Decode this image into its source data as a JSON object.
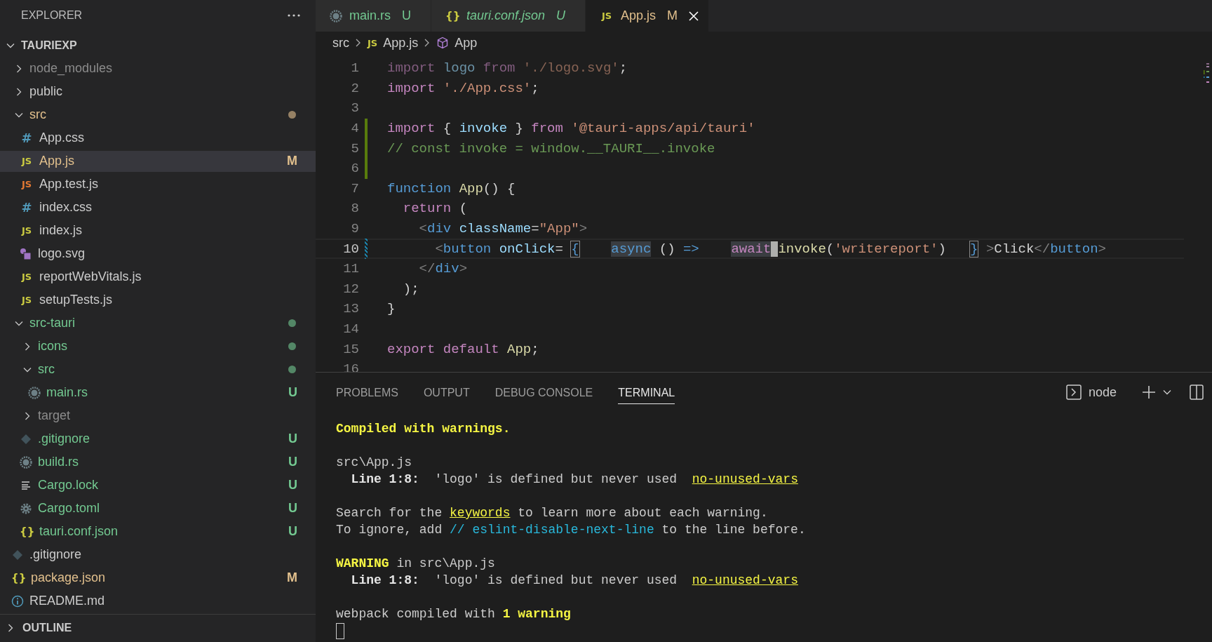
{
  "explorer": {
    "title": "EXPLORER",
    "project": {
      "name": "TAURIEXP",
      "expanded": true,
      "children": [
        {
          "name": "node_modules",
          "kind": "folder",
          "expanded": false,
          "color": "#8c8c8c",
          "dot": false,
          "selected": false
        },
        {
          "name": "public",
          "kind": "folder",
          "expanded": false,
          "color": "#cccccc",
          "dot": false,
          "selected": false
        },
        {
          "name": "src",
          "kind": "folder",
          "expanded": true,
          "color": "#e2c08d",
          "dot": true,
          "selected": false,
          "children": [
            {
              "name": "App.css",
              "kind": "css",
              "icon": "#",
              "color": "#cccccc",
              "selected": false
            },
            {
              "name": "App.js",
              "kind": "js",
              "icon": "JS",
              "color": "#e2c08d",
              "badge": "M",
              "selected": true
            },
            {
              "name": "App.test.js",
              "kind": "jstest",
              "icon": "JS",
              "color": "#cccccc",
              "selected": false
            },
            {
              "name": "index.css",
              "kind": "css",
              "icon": "#",
              "color": "#cccccc",
              "selected": false
            },
            {
              "name": "index.js",
              "kind": "js",
              "icon": "JS",
              "color": "#cccccc",
              "selected": false
            },
            {
              "name": "logo.svg",
              "kind": "svg",
              "color": "#cccccc",
              "selected": false
            },
            {
              "name": "reportWebVitals.js",
              "kind": "js",
              "icon": "JS",
              "color": "#cccccc",
              "selected": false
            },
            {
              "name": "setupTests.js",
              "kind": "js",
              "icon": "JS",
              "color": "#cccccc",
              "selected": false
            }
          ]
        },
        {
          "name": "src-tauri",
          "kind": "folder",
          "expanded": true,
          "color": "#73c991",
          "dot": true,
          "selected": false,
          "children": [
            {
              "name": "icons",
              "kind": "folder",
              "expanded": false,
              "color": "#73c991",
              "dot": true,
              "selected": false
            },
            {
              "name": "src",
              "kind": "folder",
              "expanded": true,
              "color": "#73c991",
              "dot": true,
              "selected": false,
              "children": [
                {
                  "name": "main.rs",
                  "kind": "rust",
                  "color": "#73c991",
                  "badge": "U",
                  "selected": false
                }
              ]
            },
            {
              "name": "target",
              "kind": "folder",
              "expanded": false,
              "color": "#8c8c8c",
              "dot": false,
              "selected": false
            },
            {
              "name": ".gitignore",
              "kind": "git",
              "color": "#73c991",
              "badge": "U",
              "selected": false
            },
            {
              "name": "build.rs",
              "kind": "rust",
              "color": "#73c991",
              "badge": "U",
              "selected": false
            },
            {
              "name": "Cargo.lock",
              "kind": "lines",
              "color": "#73c991",
              "badge": "U",
              "selected": false
            },
            {
              "name": "Cargo.toml",
              "kind": "gear",
              "color": "#73c991",
              "badge": "U",
              "selected": false
            },
            {
              "name": "tauri.conf.json",
              "kind": "json",
              "icon": "{}",
              "color": "#73c991",
              "badge": "U",
              "selected": false
            }
          ]
        },
        {
          "name": ".gitignore",
          "kind": "git",
          "color": "#cccccc",
          "selected": false
        },
        {
          "name": "package.json",
          "kind": "json",
          "icon": "{}",
          "color": "#e2c08d",
          "badge": "M",
          "selected": false
        },
        {
          "name": "README.md",
          "kind": "info",
          "color": "#cccccc",
          "selected": false
        }
      ]
    },
    "outline": {
      "title": "OUTLINE",
      "expanded": false
    }
  },
  "tabs": [
    {
      "label": "main.rs",
      "kind": "rust",
      "badge": "U",
      "color": "#73c991",
      "preview": false,
      "selected": false
    },
    {
      "label": "tauri.conf.json",
      "kind": "json",
      "icon": "{}",
      "badge": "U",
      "color": "#73c991",
      "preview": true,
      "selected": false
    },
    {
      "label": "App.js",
      "kind": "js",
      "icon": "JS",
      "badge": "M",
      "color": "#e2c08d",
      "preview": false,
      "selected": true
    }
  ],
  "breadcrumb": [
    {
      "label": "src",
      "kind": "folder"
    },
    {
      "label": "App.js",
      "kind": "js",
      "icon": "JS"
    },
    {
      "label": "App",
      "kind": "component"
    }
  ],
  "code": [
    {
      "n": "1",
      "kind": "plain",
      "current": false,
      "tokens": [
        {
          "t": "import",
          "kind": "kw",
          "dim": true
        },
        {
          "t": " logo ",
          "kind": "var",
          "dim": true
        },
        {
          "t": "from",
          "kind": "kw",
          "dim": true
        },
        {
          "t": " './logo.svg'",
          "kind": "str",
          "dim": true
        },
        {
          "t": ";",
          "kind": "plain",
          "dim": false
        }
      ]
    },
    {
      "n": "2",
      "kind": "plain",
      "current": false,
      "tokens": [
        {
          "t": "import",
          "kind": "kw"
        },
        {
          "t": " './App.css'",
          "kind": "str"
        },
        {
          "t": ";",
          "kind": "plain"
        }
      ]
    },
    {
      "n": "3",
      "kind": "plain",
      "current": false
    },
    {
      "n": "4",
      "kind": "added",
      "current": false,
      "tokens": [
        {
          "t": "import",
          "kind": "kw"
        },
        {
          "t": " { ",
          "kind": "plain"
        },
        {
          "t": "invoke",
          "kind": "var"
        },
        {
          "t": " } ",
          "kind": "plain"
        },
        {
          "t": "from",
          "kind": "kw"
        },
        {
          "t": " '@tauri-apps/api/tauri'",
          "kind": "str"
        }
      ]
    },
    {
      "n": "5",
      "kind": "added",
      "current": false,
      "tokens": [
        {
          "t": "// const invoke = window.__TAURI__.invoke",
          "kind": "cmt"
        }
      ]
    },
    {
      "n": "6",
      "kind": "added",
      "current": false
    },
    {
      "n": "7",
      "kind": "plain",
      "current": false,
      "tokens": [
        {
          "t": "function ",
          "kind": "storage"
        },
        {
          "t": "App",
          "kind": "fn"
        },
        {
          "t": "() {",
          "kind": "plain"
        }
      ]
    },
    {
      "n": "8",
      "kind": "plain",
      "current": false,
      "tokens": [
        {
          "t": "  return",
          "kind": "kw"
        },
        {
          "t": " (",
          "kind": "plain"
        }
      ]
    },
    {
      "n": "9",
      "kind": "plain",
      "current": false,
      "tokens": [
        {
          "t": "    <",
          "kind": "grey"
        },
        {
          "t": "div ",
          "kind": "tag"
        },
        {
          "t": "className",
          "kind": "var"
        },
        {
          "t": "=",
          "kind": "plain"
        },
        {
          "t": "\"App\"",
          "kind": "str"
        },
        {
          "t": ">",
          "kind": "grey"
        }
      ]
    },
    {
      "n": "10",
      "kind": "modified",
      "current": true,
      "tokens": [
        {
          "t": "      <",
          "kind": "grey"
        },
        {
          "t": "button ",
          "kind": "tag"
        },
        {
          "t": "onClick",
          "kind": "var"
        },
        {
          "t": "= ",
          "kind": "plain"
        },
        {
          "t": "{",
          "kind": "brace",
          "match": true
        },
        {
          "t": "    async",
          "kind": "storage",
          "hl": true
        },
        {
          "t": " () ",
          "kind": "plain"
        },
        {
          "t": "=>",
          "kind": "storage"
        },
        {
          "t": "    await",
          "kind": "kw",
          "hl": true,
          "caret": true
        },
        {
          "t": "invoke",
          "kind": "fn"
        },
        {
          "t": "(",
          "kind": "plain"
        },
        {
          "t": "'writereport'",
          "kind": "str"
        },
        {
          "t": ")",
          "kind": "plain"
        },
        {
          "t": "   }",
          "kind": "brace",
          "match": true
        },
        {
          "t": " >",
          "kind": "grey"
        },
        {
          "t": "Click",
          "kind": "plain"
        },
        {
          "t": "</",
          "kind": "grey"
        },
        {
          "t": "button",
          "kind": "tag"
        },
        {
          "t": ">",
          "kind": "grey"
        }
      ]
    },
    {
      "n": "11",
      "kind": "plain",
      "current": false,
      "tokens": [
        {
          "t": "    </",
          "kind": "grey"
        },
        {
          "t": "div",
          "kind": "tag"
        },
        {
          "t": ">",
          "kind": "grey"
        }
      ]
    },
    {
      "n": "12",
      "kind": "plain",
      "current": false,
      "tokens": [
        {
          "t": "  );",
          "kind": "plain"
        }
      ]
    },
    {
      "n": "13",
      "kind": "plain",
      "current": false,
      "tokens": [
        {
          "t": "}",
          "kind": "plain"
        }
      ]
    },
    {
      "n": "14",
      "kind": "plain",
      "current": false
    },
    {
      "n": "15",
      "kind": "plain",
      "current": false,
      "tokens": [
        {
          "t": "export default",
          "kind": "kw"
        },
        {
          "t": " App",
          "kind": "fn"
        },
        {
          "t": ";",
          "kind": "plain"
        }
      ]
    },
    {
      "n": "16",
      "kind": "plain",
      "current": false
    }
  ],
  "panel": {
    "tabs": [
      {
        "label": "PROBLEMS",
        "selected": false
      },
      {
        "label": "OUTPUT",
        "selected": false
      },
      {
        "label": "DEBUG CONSOLE",
        "selected": false
      },
      {
        "label": "TERMINAL",
        "selected": true
      }
    ],
    "profile": "node",
    "terminal": [
      {
        "gap": false,
        "segs": [
          {
            "t": "Compiled with warnings.",
            "kind": "yellow"
          }
        ]
      },
      {
        "gap": true,
        "segs": [
          {
            "t": "src\\App.js",
            "kind": "plain"
          }
        ]
      },
      {
        "gap": false,
        "segs": [
          {
            "t": "  Line 1:8:",
            "kind": "bold"
          },
          {
            "t": "  'logo' is defined but never used  ",
            "kind": "plain"
          },
          {
            "t": "no-unused-vars",
            "kind": "link"
          }
        ]
      },
      {
        "gap": true,
        "segs": [
          {
            "t": "Search for the ",
            "kind": "plain"
          },
          {
            "t": "keywords",
            "kind": "link"
          },
          {
            "t": " to learn more about each warning.",
            "kind": "plain"
          }
        ]
      },
      {
        "gap": false,
        "segs": [
          {
            "t": "To ignore, add ",
            "kind": "plain"
          },
          {
            "t": "// eslint-disable-next-line",
            "kind": "cyan"
          },
          {
            "t": " to the line before.",
            "kind": "plain"
          }
        ]
      },
      {
        "gap": true,
        "segs": [
          {
            "t": "WARNING",
            "kind": "yellow"
          },
          {
            "t": " in src\\App.js",
            "kind": "plain"
          }
        ]
      },
      {
        "gap": false,
        "segs": [
          {
            "t": "  Line 1:8:",
            "kind": "bold"
          },
          {
            "t": "  'logo' is defined but never used  ",
            "kind": "plain"
          },
          {
            "t": "no-unused-vars",
            "kind": "link"
          }
        ]
      },
      {
        "gap": true,
        "segs": [
          {
            "t": "webpack compiled with ",
            "kind": "plain"
          },
          {
            "t": "1 warning",
            "kind": "yellow"
          }
        ]
      }
    ],
    "cursor": true
  }
}
